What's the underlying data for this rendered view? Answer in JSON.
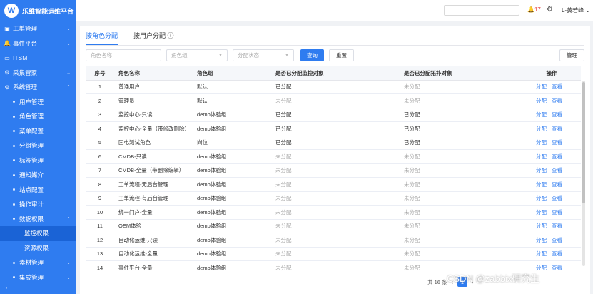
{
  "app": {
    "title": "乐维智能运维平台",
    "logo_letter": "W"
  },
  "sidebar": {
    "items": [
      {
        "label": "工单管理",
        "icon": "document-icon",
        "chevron": "⌄"
      },
      {
        "label": "事件平台",
        "icon": "bell-icon",
        "chevron": "⌄"
      },
      {
        "label": "ITSM",
        "icon": "screen-icon",
        "chevron": ""
      },
      {
        "label": "采集管家",
        "icon": "gear-icon",
        "chevron": "⌄"
      },
      {
        "label": "系统管理",
        "icon": "gear-icon",
        "chevron": "⌃"
      }
    ],
    "sub_items": [
      "用户管理",
      "角色管理",
      "菜单配置",
      "分组管理",
      "标签管理",
      "通知媒介",
      "站点配置",
      "操作审计"
    ],
    "data_perm": {
      "label": "数据权限",
      "chevron": "⌃"
    },
    "data_perm_children": [
      "监控权限",
      "资源权限"
    ],
    "after_items": [
      {
        "label": "素材管理",
        "chevron": "⌄"
      },
      {
        "label": "集成管理",
        "chevron": "⌄"
      }
    ],
    "collapse_glyph": "←"
  },
  "topbar": {
    "notification_count": "17",
    "user": "L-黄若峰"
  },
  "tabs": [
    {
      "label": "按角色分配"
    },
    {
      "label": "按用户分配 ⓘ"
    }
  ],
  "filters": {
    "role_name_placeholder": "角色名称",
    "role_group_placeholder": "角色组",
    "status_placeholder": "分配状态",
    "query_button": "查询",
    "reset_button": "重置",
    "manage_button": "管理"
  },
  "table": {
    "headers": [
      "序号",
      "角色名称",
      "角色组",
      "是否已分配监控对象",
      "是否已分配拓扑对象",
      "操作"
    ],
    "op_assign": "分配",
    "op_view": "查看",
    "rows": [
      [
        "1",
        "普通用户",
        "默认",
        "已分配",
        "未分配"
      ],
      [
        "2",
        "管理员",
        "默认",
        "未分配",
        "未分配"
      ],
      [
        "3",
        "监控中心-只读",
        "demo体验组",
        "已分配",
        "已分配"
      ],
      [
        "4",
        "监控中心-全量（带修改删除）",
        "demo体验组",
        "已分配",
        "已分配"
      ],
      [
        "5",
        "国电测试角色",
        "岗位",
        "已分配",
        "已分配"
      ],
      [
        "6",
        "CMDB-只读",
        "demo体验组",
        "未分配",
        "未分配"
      ],
      [
        "7",
        "CMDB-全量（带删除编辑）",
        "demo体验组",
        "未分配",
        "未分配"
      ],
      [
        "8",
        "工单流程-无后台管理",
        "demo体验组",
        "未分配",
        "未分配"
      ],
      [
        "9",
        "工单流程-有后台管理",
        "demo体验组",
        "未分配",
        "未分配"
      ],
      [
        "10",
        "统一门户-全量",
        "demo体验组",
        "未分配",
        "未分配"
      ],
      [
        "11",
        "OEM体验",
        "demo体验组",
        "未分配",
        "未分配"
      ],
      [
        "12",
        "自动化运维-只读",
        "demo体验组",
        "未分配",
        "未分配"
      ],
      [
        "13",
        "自动化运维-全量",
        "demo体验组",
        "未分配",
        "未分配"
      ],
      [
        "14",
        "事件平台-全量",
        "demo体验组",
        "未分配",
        "未分配"
      ]
    ]
  },
  "pagination": {
    "total": "共 16 条",
    "current_page": "1"
  },
  "watermark": "CSDN @zabbix研究生",
  "colors": {
    "accent": "#2f7cf0",
    "danger": "#e54545"
  }
}
